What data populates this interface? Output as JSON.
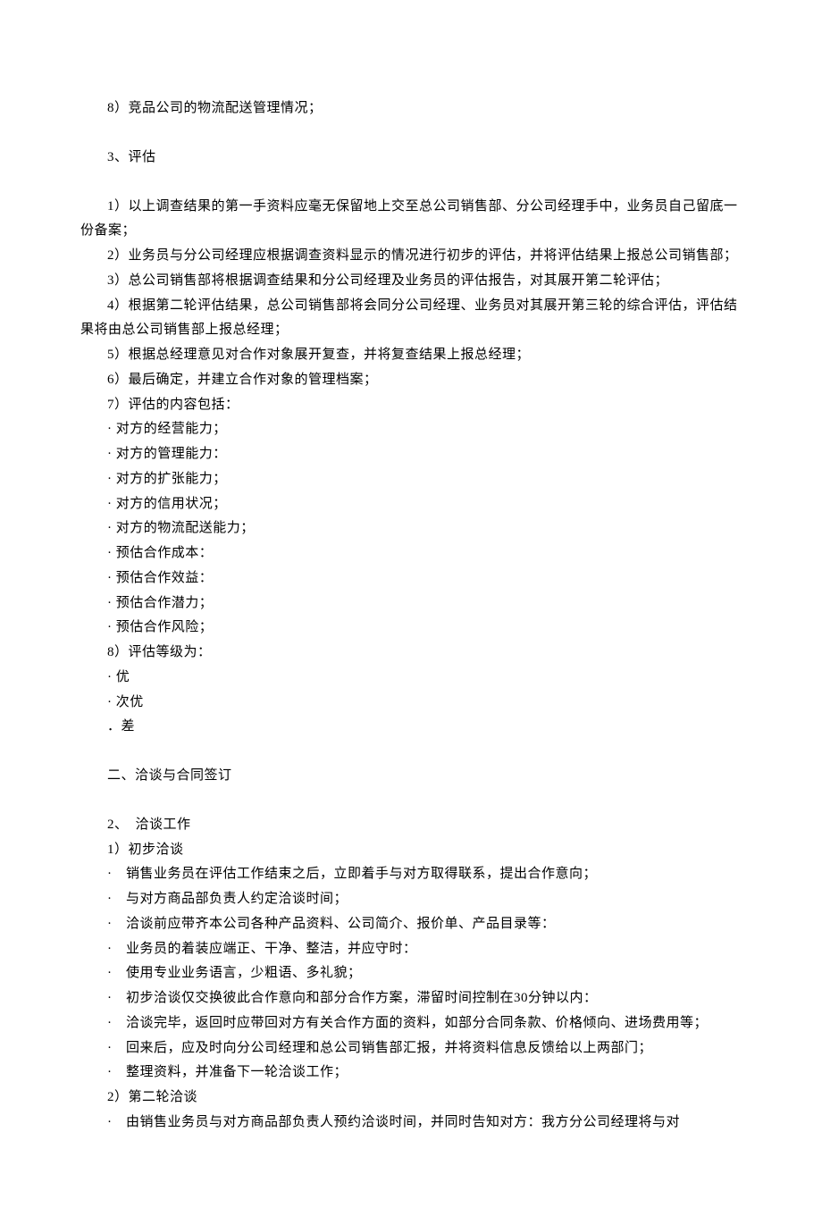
{
  "lines": [
    {
      "text": "8）竞品公司的物流配送管理情况；",
      "cls": "indent-2"
    },
    {
      "spacer": true
    },
    {
      "text": "3、评估",
      "cls": "indent-2"
    },
    {
      "spacer": true
    },
    {
      "text": "1）以上调查结果的第一手资料应毫无保留地上交至总公司销售部、分公司经理手中，业务员自己留底一份备案；",
      "cls": "indent-2"
    },
    {
      "text": "2）业务员与分公司经理应根据调查资料显示的情况进行初步的评估，并将评估结果上报总公司销售部；",
      "cls": "indent-2"
    },
    {
      "text": "3）总公司销售部将根据调查结果和分公司经理及业务员的评估报告，对其展开第二轮评估；",
      "cls": "indent-2"
    },
    {
      "text": "4）根据第二轮评估结果，总公司销售部将会同分公司经理、业务员对其展开第三轮的综合评估，评估结果将由总公司销售部上报总经理；",
      "cls": "indent-2"
    },
    {
      "text": "5）根据总经理意见对合作对象展开复查，并将复查结果上报总经理；",
      "cls": "indent-2"
    },
    {
      "text": "6）最后确定，并建立合作对象的管理档案；",
      "cls": "indent-2"
    },
    {
      "text": "7）评估的内容包括：",
      "cls": "indent-2"
    },
    {
      "text": "· 对方的经营能力；",
      "cls": "indent-2"
    },
    {
      "text": "· 对方的管理能力：",
      "cls": "indent-2"
    },
    {
      "text": "· 对方的扩张能力；",
      "cls": "indent-2"
    },
    {
      "text": "· 对方的信用状况；",
      "cls": "indent-2"
    },
    {
      "text": "· 对方的物流配送能力；",
      "cls": "indent-2"
    },
    {
      "text": "· 预估合作成本：",
      "cls": "indent-2"
    },
    {
      "text": "· 预估合作效益：",
      "cls": "indent-2"
    },
    {
      "text": "· 预估合作潜力；",
      "cls": "indent-2"
    },
    {
      "text": "· 预估合作风险；",
      "cls": "indent-2"
    },
    {
      "text": "8）评估等级为：",
      "cls": "indent-2"
    },
    {
      "text": "· 优",
      "cls": "indent-2"
    },
    {
      "text": "· 次优",
      "cls": "indent-2"
    },
    {
      "text": "．差",
      "cls": "indent-2"
    },
    {
      "spacer": true
    },
    {
      "text": "二、洽谈与合同签订",
      "cls": "indent-2"
    },
    {
      "spacer": true
    },
    {
      "text": "2、　洽谈工作",
      "cls": "indent-2"
    },
    {
      "text": "1）初步洽谈",
      "cls": "indent-2"
    },
    {
      "text": "·　销售业务员在评估工作结束之后，立即着手与对方取得联系，提出合作意向；",
      "cls": "indent-2"
    },
    {
      "text": "·　与对方商品部负责人约定洽谈时间；",
      "cls": "indent-2"
    },
    {
      "text": "·　洽谈前应带齐本公司各种产品资料、公司简介、报价单、产品目录等：",
      "cls": "indent-2"
    },
    {
      "text": "·　业务员的着装应端正、干净、整洁，并应守时：",
      "cls": "indent-2"
    },
    {
      "text": "·　使用专业业务语言，少粗语、多礼貌；",
      "cls": "indent-2"
    },
    {
      "text": "·　初步洽谈仅交换彼此合作意向和部分合作方案，滞留时间控制在30分钟以内：",
      "cls": "indent-2"
    },
    {
      "text": "·　洽谈完毕，返回时应带回对方有关合作方面的资料，如部分合同条款、价格倾向、进场费用等；",
      "cls": "indent-2"
    },
    {
      "text": "·　回来后，应及时向分公司经理和总公司销售部汇报，并将资料信息反馈给以上两部门；",
      "cls": "indent-2"
    },
    {
      "text": "·　整理资料，并准备下一轮洽谈工作；",
      "cls": "indent-2"
    },
    {
      "text": "2）第二轮洽谈",
      "cls": "indent-2"
    },
    {
      "text": "·　由销售业务员与对方商品部负责人预约洽谈时间，并同时告知对方：我方分公司经理将与对",
      "cls": "indent-2"
    }
  ]
}
